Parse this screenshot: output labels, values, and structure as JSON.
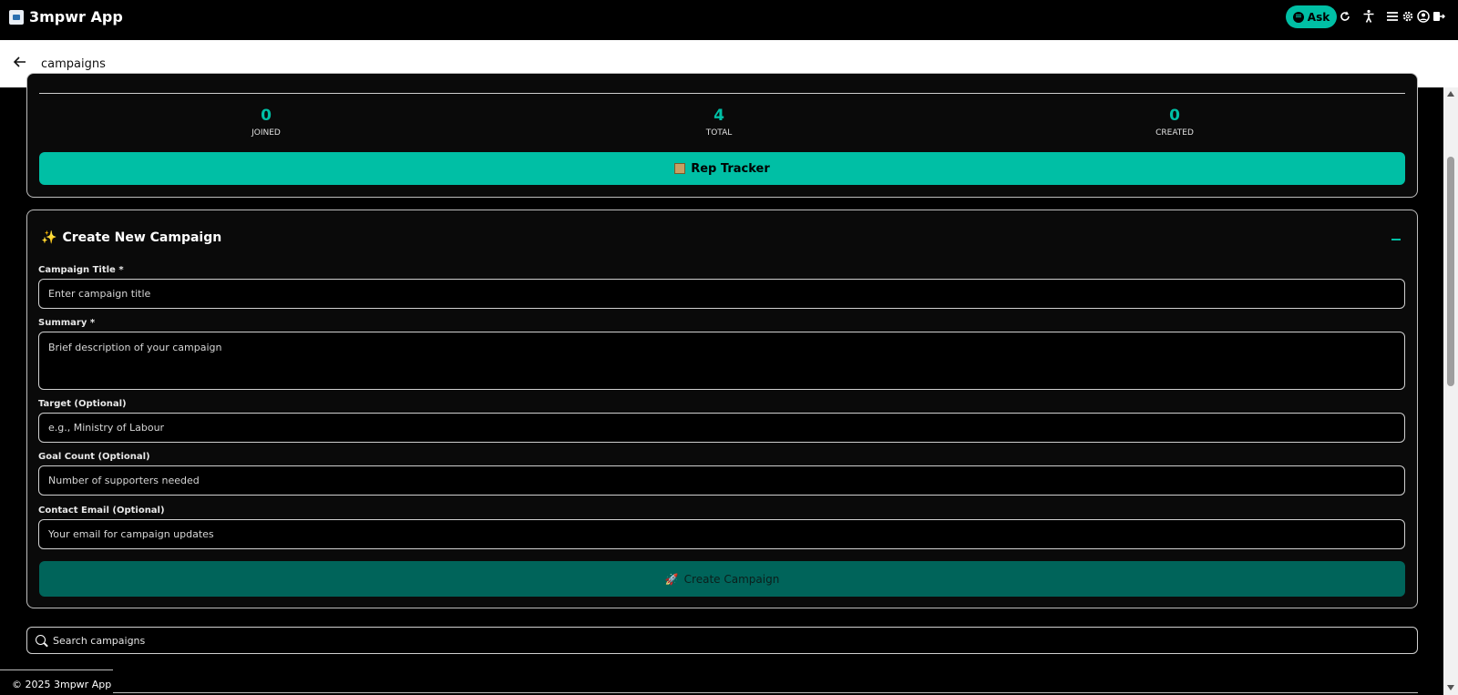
{
  "app": {
    "title": "3mpwr App"
  },
  "topbar": {
    "ask_label": "Ask"
  },
  "subheader": {
    "title": "campaigns"
  },
  "stats": [
    {
      "value": "0",
      "label": "JOINED"
    },
    {
      "value": "4",
      "label": "TOTAL"
    },
    {
      "value": "0",
      "label": "CREATED"
    }
  ],
  "rep_tracker": {
    "label": "Rep Tracker"
  },
  "create_campaign": {
    "heading": "Create New Campaign",
    "fields": {
      "title": {
        "label": "Campaign Title *",
        "placeholder": "Enter campaign title"
      },
      "summary": {
        "label": "Summary *",
        "placeholder": "Brief description of your campaign"
      },
      "target": {
        "label": "Target (Optional)",
        "placeholder": "e.g., Ministry of Labour"
      },
      "goal": {
        "label": "Goal Count (Optional)",
        "placeholder": "Number of supporters needed"
      },
      "email": {
        "label": "Contact Email (Optional)",
        "placeholder": "Your email for campaign updates"
      }
    },
    "submit_label": "Create Campaign"
  },
  "search": {
    "placeholder": "Search campaigns"
  },
  "footer": {
    "text": "© 2025 3mpwr App"
  },
  "colors": {
    "accent": "#00bfa5",
    "accent_dark": "#00645a",
    "background": "#000000"
  }
}
